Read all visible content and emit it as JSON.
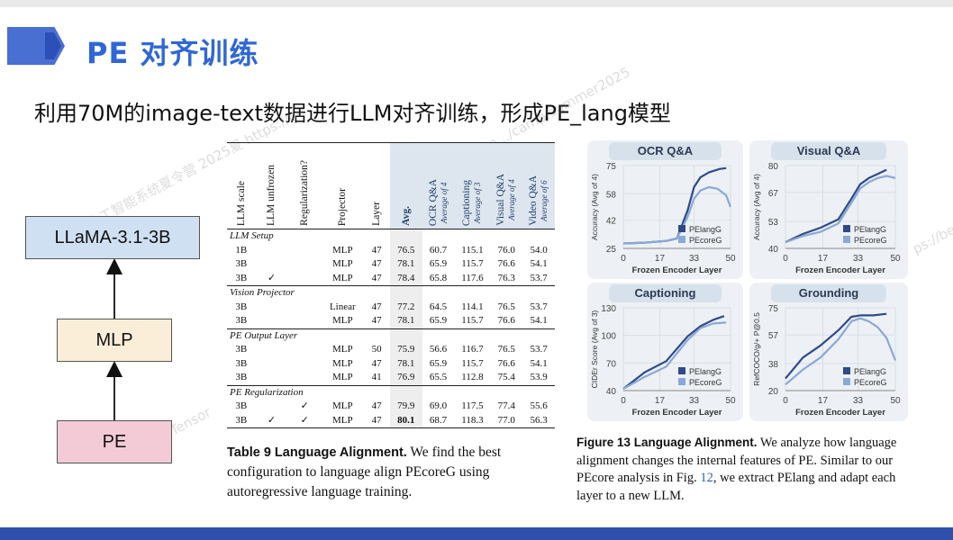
{
  "slide": {
    "title": "PE 对齐训练",
    "subtitle": "利用70M的image-text数据进行LLM对齐训练，形成PE_lang模型"
  },
  "watermarks": [
    "大模型与人工智能系统夏令营 2025夏 https://be",
    "https://beta.../camp/summer2025",
    "ps://be",
    "iniTensor",
    "ten..."
  ],
  "diagram": {
    "top": "LLaMA-3.1-3B",
    "middle": "MLP",
    "bottom": "PE"
  },
  "table": {
    "headers": [
      "LLM scale",
      "LLM unfrozen",
      "Regularization?",
      "Projector",
      "Layer",
      "Avg.",
      "OCR Q&A",
      "Captioning",
      "Visual Q&A",
      "Video Q&A"
    ],
    "header_subs": [
      "",
      "",
      "",
      "",
      "",
      "",
      "Average of 4",
      "Average of 3",
      "Average of 4",
      "Average of 6"
    ],
    "groups": [
      {
        "name": "LLM Setup",
        "rows": [
          [
            "1B",
            "",
            "",
            "MLP",
            "47",
            "76.5",
            "60.7",
            "115.1",
            "76.0",
            "54.0"
          ],
          [
            "3B",
            "",
            "",
            "MLP",
            "47",
            "78.1",
            "65.9",
            "115.7",
            "76.6",
            "54.1"
          ],
          [
            "3B",
            "✓",
            "",
            "MLP",
            "47",
            "78.4",
            "65.8",
            "117.6",
            "76.3",
            "53.7"
          ]
        ]
      },
      {
        "name": "Vision Projector",
        "rows": [
          [
            "3B",
            "",
            "",
            "Linear",
            "47",
            "77.2",
            "64.5",
            "114.1",
            "76.5",
            "53.7"
          ],
          [
            "3B",
            "",
            "",
            "MLP",
            "47",
            "78.1",
            "65.9",
            "115.7",
            "76.6",
            "54.1"
          ]
        ]
      },
      {
        "name": "PE Output Layer",
        "rows": [
          [
            "3B",
            "",
            "",
            "MLP",
            "50",
            "75.9",
            "56.6",
            "116.7",
            "76.5",
            "53.7"
          ],
          [
            "3B",
            "",
            "",
            "MLP",
            "47",
            "78.1",
            "65.9",
            "115.7",
            "76.6",
            "54.1"
          ],
          [
            "3B",
            "",
            "",
            "MLP",
            "41",
            "76.9",
            "65.5",
            "112.8",
            "75.4",
            "53.9"
          ]
        ]
      },
      {
        "name": "PE Regularization",
        "rows": [
          [
            "3B",
            "",
            "✓",
            "MLP",
            "47",
            "79.9",
            "69.0",
            "117.5",
            "77.4",
            "55.6"
          ],
          [
            "3B",
            "✓",
            "✓",
            "MLP",
            "47",
            "80.1",
            "68.7",
            "118.3",
            "77.0",
            "56.3"
          ]
        ]
      }
    ],
    "caption_label": "Table 9  Language Alignment.",
    "caption_text": "We find the best configuration to language align PEcoreG using autoregressive language training."
  },
  "figure": {
    "caption_label": "Figure 13  Language Alignment.",
    "caption_text_1": "We analyze how language alignment changes the internal features of PE. Similar to our PEcore analysis in Fig.",
    "caption_ref": "12",
    "caption_text_2": ", we extract PElang and adapt each layer to a new LLM."
  },
  "chart_data": [
    {
      "type": "line",
      "title": "OCR Q&A",
      "xlabel": "Frozen Encoder Layer",
      "ylabel": "Accuracy (Avg of 4)",
      "x_ticks": [
        0,
        17,
        33,
        50
      ],
      "y_ticks": [
        25,
        42,
        58,
        75
      ],
      "xlim": [
        0,
        50
      ],
      "ylim": [
        25,
        75
      ],
      "series": [
        {
          "name": "PElangG",
          "color": "#2f4a8a",
          "x": [
            0,
            10,
            20,
            25,
            30,
            33,
            36,
            40,
            45,
            48
          ],
          "y": [
            28,
            28.5,
            29.5,
            31,
            48,
            62,
            68,
            71,
            73,
            73.5
          ]
        },
        {
          "name": "PEcoreG",
          "color": "#8aa8d8",
          "x": [
            0,
            10,
            20,
            25,
            30,
            33,
            36,
            40,
            44,
            48,
            50
          ],
          "y": [
            28,
            28.5,
            29.5,
            31,
            44,
            55,
            60,
            62,
            61,
            57,
            50
          ]
        }
      ]
    },
    {
      "type": "line",
      "title": "Visual Q&A",
      "xlabel": "Frozen Encoder Layer",
      "ylabel": "Accuracy (Avg of 4)",
      "x_ticks": [
        0,
        17,
        33,
        50
      ],
      "y_ticks": [
        40,
        53,
        67,
        80
      ],
      "xlim": [
        0,
        50
      ],
      "ylim": [
        40,
        80
      ],
      "series": [
        {
          "name": "PElangG",
          "color": "#2f4a8a",
          "x": [
            0,
            8,
            16,
            24,
            30,
            34,
            38,
            42,
            46
          ],
          "y": [
            43,
            47,
            50,
            54,
            64,
            71,
            74,
            76,
            78
          ]
        },
        {
          "name": "PEcoreG",
          "color": "#8aa8d8",
          "x": [
            0,
            8,
            16,
            24,
            30,
            34,
            38,
            42,
            46,
            50
          ],
          "y": [
            43,
            46,
            48,
            52,
            62,
            69,
            72,
            74,
            75,
            74
          ]
        }
      ]
    },
    {
      "type": "line",
      "title": "Captioning",
      "xlabel": "Frozen Encoder Layer",
      "ylabel": "CIDEr Score (Avg of 3)",
      "x_ticks": [
        0,
        17,
        33,
        50
      ],
      "y_ticks": [
        40,
        70,
        100,
        130
      ],
      "xlim": [
        0,
        50
      ],
      "ylim": [
        40,
        130
      ],
      "series": [
        {
          "name": "PElangG",
          "color": "#2f4a8a",
          "x": [
            0,
            10,
            20,
            30,
            36,
            42,
            47
          ],
          "y": [
            42,
            60,
            72,
            99,
            110,
            117,
            121
          ]
        },
        {
          "name": "PEcoreG",
          "color": "#8aa8d8",
          "x": [
            0,
            10,
            20,
            30,
            36,
            42,
            48
          ],
          "y": [
            42,
            55,
            66,
            95,
            108,
            113,
            114
          ]
        }
      ]
    },
    {
      "type": "line",
      "title": "Grounding",
      "xlabel": "Frozen Encoder Layer",
      "ylabel": "RefCOCO/g/+ P@0.5",
      "x_ticks": [
        0,
        17,
        33,
        50
      ],
      "y_ticks": [
        20,
        38,
        57,
        75
      ],
      "xlim": [
        0,
        50
      ],
      "ylim": [
        20,
        75
      ],
      "series": [
        {
          "name": "PElangG",
          "color": "#2f4a8a",
          "x": [
            0,
            8,
            16,
            24,
            30,
            34,
            40,
            46
          ],
          "y": [
            28,
            42,
            50,
            60,
            69,
            70,
            70,
            71
          ]
        },
        {
          "name": "PEcoreG",
          "color": "#8aa8d8",
          "x": [
            0,
            8,
            16,
            24,
            30,
            34,
            38,
            42,
            46,
            50
          ],
          "y": [
            24,
            34,
            42,
            54,
            66,
            68,
            66,
            62,
            55,
            40
          ]
        }
      ]
    }
  ]
}
